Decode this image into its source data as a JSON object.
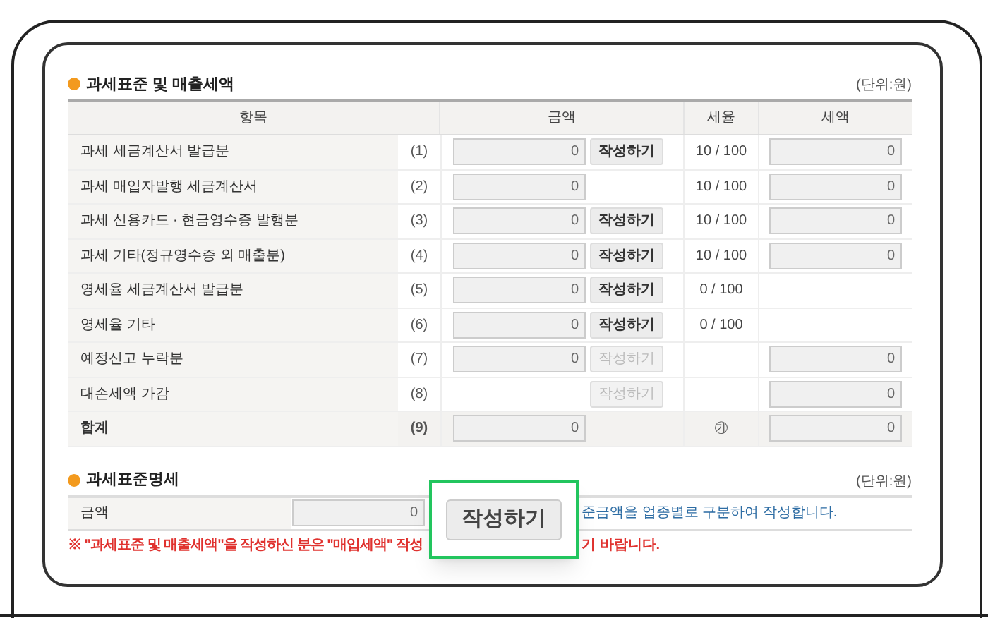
{
  "section1": {
    "title": "과세표준 및 매출세액",
    "unit": "(단위:원)",
    "columns": [
      "항목",
      "금액",
      "세율",
      "세액"
    ],
    "rows": [
      {
        "kind": "item",
        "label": "과세 세금계산서 발급분",
        "number": "(1)",
        "amount": "0",
        "button": {
          "label": "작성하기",
          "disabled": false
        },
        "rate": "10 / 100",
        "tax": "0"
      },
      {
        "kind": "item",
        "label": "과세 매입자발행 세금계산서",
        "number": "(2)",
        "amount": "0",
        "rate": "10 / 100",
        "tax": "0"
      },
      {
        "kind": "item",
        "label": "과세 신용카드 · 현금영수증 발행분",
        "number": "(3)",
        "amount": "0",
        "button": {
          "label": "작성하기",
          "disabled": false
        },
        "rate": "10 / 100",
        "tax": "0"
      },
      {
        "kind": "item",
        "label": "과세 기타(정규영수증 외 매출분)",
        "number": "(4)",
        "amount": "0",
        "button": {
          "label": "작성하기",
          "disabled": false
        },
        "rate": "10 / 100",
        "tax": "0"
      },
      {
        "kind": "item",
        "label": "영세율 세금계산서 발급분",
        "number": "(5)",
        "amount": "0",
        "button": {
          "label": "작성하기",
          "disabled": false
        },
        "rate": "0 / 100"
      },
      {
        "kind": "item",
        "label": "영세율 기타",
        "number": "(6)",
        "amount": "0",
        "button": {
          "label": "작성하기",
          "disabled": false
        },
        "rate": "0 / 100"
      },
      {
        "kind": "item",
        "label": "예정신고 누락분",
        "number": "(7)",
        "amount": "0",
        "button": {
          "label": "작성하기",
          "disabled": true
        },
        "tax": "0"
      },
      {
        "kind": "item",
        "label": "대손세액 가감",
        "number": "(8)",
        "button": {
          "label": "작성하기",
          "disabled": true
        },
        "tax": "0"
      },
      {
        "kind": "total",
        "label": "합계",
        "number": "(9)",
        "amount": "0",
        "rate": "㉮",
        "tax": "0"
      }
    ]
  },
  "section2": {
    "title": "과세표준명세",
    "unit": "(단위:원)",
    "label": "금액",
    "amount": "0",
    "description": "준금액을 업종별로 구분하여 작성합니다."
  },
  "note": [
    "※ \"과세표준 및 매출세액\"을 작성하신 분은 \"매입세액\" 작성",
    "기 바랍니다."
  ],
  "popup": {
    "button": "작성하기",
    "highlighted": true
  }
}
